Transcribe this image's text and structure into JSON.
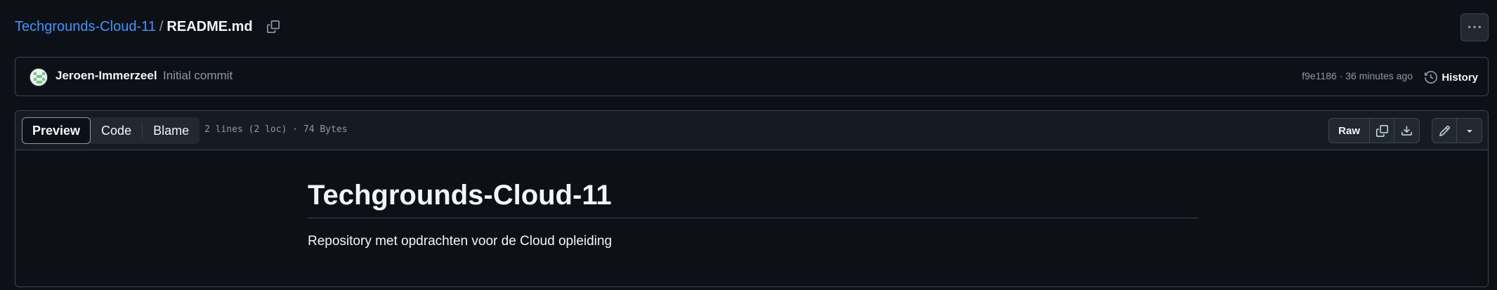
{
  "breadcrumb": {
    "repo": "Techgrounds-Cloud-11",
    "separator": "/",
    "file": "README.md"
  },
  "commit": {
    "author": "Jeroen-Immerzeel",
    "message": "Initial commit",
    "meta": "f9e1186 · 36 minutes ago",
    "history_label": "History"
  },
  "file_header": {
    "tabs": [
      {
        "label": "Preview",
        "active": true
      },
      {
        "label": "Code",
        "active": false
      },
      {
        "label": "Blame",
        "active": false
      }
    ],
    "info": "2 lines (2 loc) · 74 Bytes",
    "raw_label": "Raw"
  },
  "readme": {
    "heading": "Techgrounds-Cloud-11",
    "paragraph": "Repository met opdrachten voor de Cloud opleiding"
  },
  "icons": {
    "copy_path": "copy-icon",
    "more": "kebab-horizontal-icon",
    "history": "history-icon",
    "copy_raw": "copy-icon",
    "download": "download-icon",
    "edit": "pencil-icon",
    "dropdown": "triangle-down-icon"
  },
  "colors": {
    "background": "#0d1117",
    "link": "#4493f8",
    "border": "#3d444d",
    "muted_text": "#9198a1",
    "text": "#f0f6fc"
  }
}
